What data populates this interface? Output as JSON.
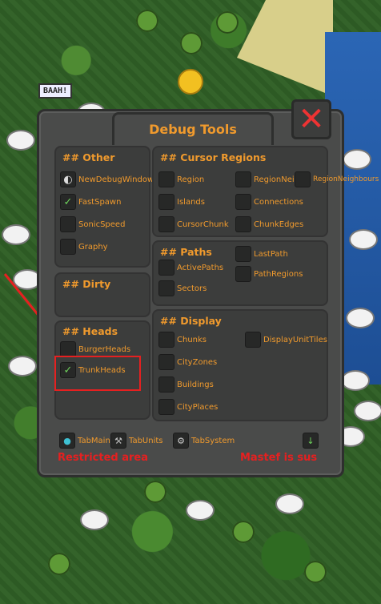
{
  "world": {
    "speech_bubble": "BAAH!"
  },
  "panel": {
    "title": "Debug Tools",
    "close_icon": "close-icon"
  },
  "sections": {
    "other": {
      "title": "## Other",
      "items": [
        {
          "label": "NewDebugWindow",
          "checked": false,
          "icon": "moon-icon"
        },
        {
          "label": "FastSpawn",
          "checked": true
        },
        {
          "label": "SonicSpeed",
          "checked": false
        },
        {
          "label": "Graphy",
          "checked": false
        }
      ]
    },
    "dirty": {
      "title": "## Dirty"
    },
    "heads": {
      "title": "## Heads",
      "items": [
        {
          "label": "BurgerHeads",
          "checked": false
        },
        {
          "label": "TrunkHeads",
          "checked": true
        }
      ]
    },
    "cursor_regions": {
      "title": "## Cursor Regions",
      "items": [
        {
          "label": "Region"
        },
        {
          "label": "RegionNei"
        },
        {
          "label": "RegionNeighbours"
        },
        {
          "label": "Islands"
        },
        {
          "label": "Connections"
        },
        {
          "label": "CursorChunk"
        },
        {
          "label": "ChunkEdges"
        }
      ]
    },
    "paths": {
      "title": "## Paths",
      "items": [
        {
          "label": "ActivePaths"
        },
        {
          "label": "LastPath"
        },
        {
          "label": "PathRegions"
        },
        {
          "label": "Sectors"
        }
      ]
    },
    "display": {
      "title": "## Display",
      "items": [
        {
          "label": "Chunks"
        },
        {
          "label": "DisplayUnitTiles"
        },
        {
          "label": "CityZones"
        },
        {
          "label": "Buildings"
        },
        {
          "label": "CityPlaces"
        }
      ]
    }
  },
  "footer": {
    "tabs": [
      {
        "label": "TabMain",
        "icon": "globe-icon"
      },
      {
        "label": "TabUnits",
        "icon": "pickaxe-icon"
      },
      {
        "label": "TabSystem",
        "icon": "gear-icon"
      }
    ],
    "restricted": "Restricted area",
    "sus": "Mastef is sus"
  },
  "colors": {
    "accent": "#f09a2d",
    "panel_bg": "#4a4b4a",
    "check": "#6fd35c",
    "alert": "#e62020"
  }
}
